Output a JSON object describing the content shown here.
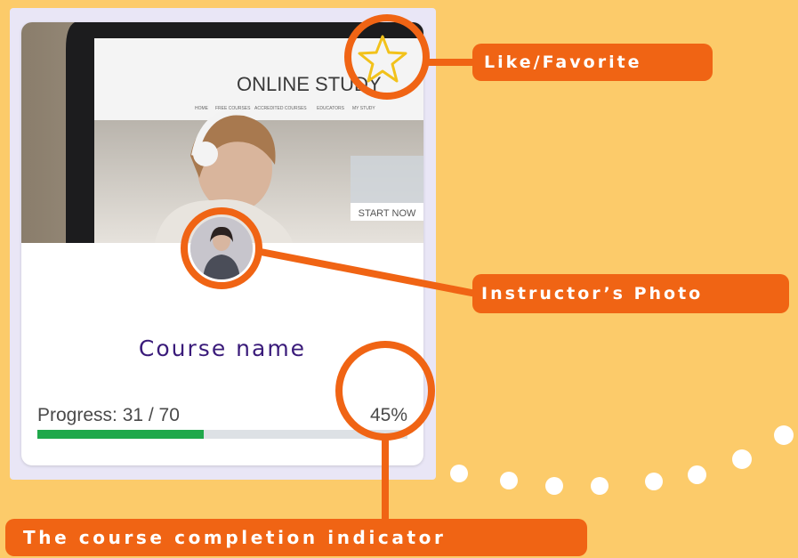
{
  "course_card": {
    "title": "Course name",
    "progress_label": "Progress: 31 / 70",
    "progress_percent": "45%",
    "progress_fraction": 0.45,
    "progress_color": "#1FA84A",
    "track_color": "#DDE1E5",
    "image": {
      "site_title": "ONLINE STUDY",
      "nav_items": [
        "HOME",
        "FREE COURSES",
        "ACCREDITED COURSES",
        "EDUCATORS",
        "MY STUDY"
      ],
      "cta": "START NOW"
    },
    "favorite_icon": "star-icon"
  },
  "callouts": {
    "favorite": "Like/Favorite",
    "instructor": "Instructor’s Photo",
    "completion": "The course completion indicator"
  },
  "colors": {
    "background": "#FCCB6A",
    "accent": "#F06414",
    "title": "#3A1B7A"
  }
}
